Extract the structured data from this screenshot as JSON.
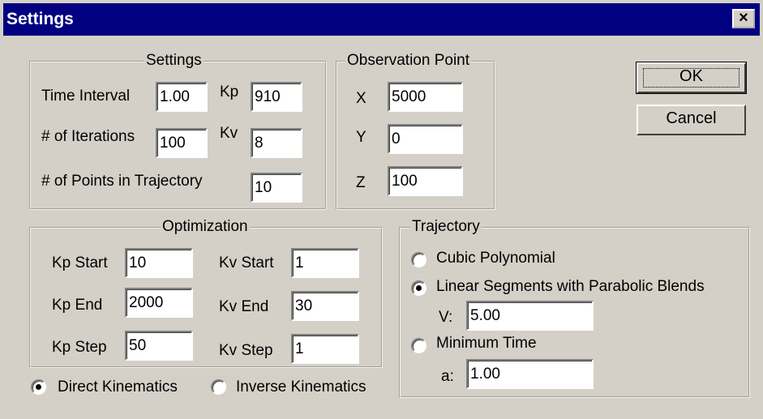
{
  "window": {
    "title": "Settings",
    "close_glyph": "×"
  },
  "settings_group": {
    "legend": "Settings",
    "time_interval_label": "Time Interval",
    "time_interval_value": "1.00",
    "kp_label": "Kp",
    "kp_value": "910",
    "iterations_label": "# of Iterations",
    "iterations_value": "100",
    "kv_label": "Kv",
    "kv_value": "8",
    "points_label": "# of Points in Trajectory",
    "points_value": "10"
  },
  "observation_group": {
    "legend": "Observation Point",
    "x_label": "X",
    "x_value": "5000",
    "y_label": "Y",
    "y_value": "0",
    "z_label": "Z",
    "z_value": "100"
  },
  "buttons": {
    "ok": "OK",
    "cancel": "Cancel"
  },
  "optimization_group": {
    "legend": "Optimization",
    "kp_start_label": "Kp Start",
    "kp_start_value": "10",
    "kv_start_label": "Kv Start",
    "kv_start_value": "1",
    "kp_end_label": "Kp End",
    "kp_end_value": "2000",
    "kv_end_label": "Kv End",
    "kv_end_value": "30",
    "kp_step_label": "Kp Step",
    "kp_step_value": "50",
    "kv_step_label": "Kv Step",
    "kv_step_value": "1"
  },
  "kinematics": {
    "direct_label": "Direct Kinematics",
    "direct_selected": true,
    "inverse_label": "Inverse Kinematics",
    "inverse_selected": false
  },
  "trajectory_group": {
    "legend": "Trajectory",
    "cubic_label": "Cubic Polynomial",
    "cubic_selected": false,
    "linear_label": "Linear Segments with Parabolic Blends",
    "linear_selected": true,
    "v_label": "V:",
    "v_value": "5.00",
    "min_time_label": "Minimum Time",
    "min_time_selected": false,
    "a_label": "a:",
    "a_value": "1.00"
  },
  "colors": {
    "titlebar": "#000080",
    "face": "#d4d0c8",
    "field": "#ffffff"
  }
}
